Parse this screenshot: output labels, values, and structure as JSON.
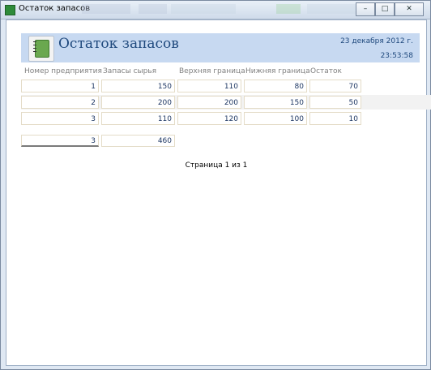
{
  "window": {
    "title": "Остаток запасов",
    "controls": {
      "minimize": "–",
      "maximize": "□",
      "close": "✕"
    }
  },
  "report": {
    "title": "Остаток запасов",
    "date": "23 декабря 2012 г.",
    "time": "23:53:58",
    "columns": [
      "Номер предприятия",
      "Запасы сырья",
      "Верхняя граница",
      "Нижняя граница",
      "Остаток"
    ],
    "rows": [
      [
        "1",
        "150",
        "110",
        "80",
        "70"
      ],
      [
        "2",
        "200",
        "200",
        "150",
        "50"
      ],
      [
        "3",
        "110",
        "120",
        "100",
        "10"
      ]
    ],
    "totals": {
      "count": "3",
      "sum": "460"
    },
    "pager": "Страница 1 из 1"
  },
  "icons": {
    "window_icon": "access-report-icon",
    "logo": "notebook-icon"
  },
  "colors": {
    "header_band": "#c7d9f1",
    "title_text": "#1f497d",
    "alt_row": "#f2f2f2",
    "cell_border": "#e4dcc8"
  }
}
